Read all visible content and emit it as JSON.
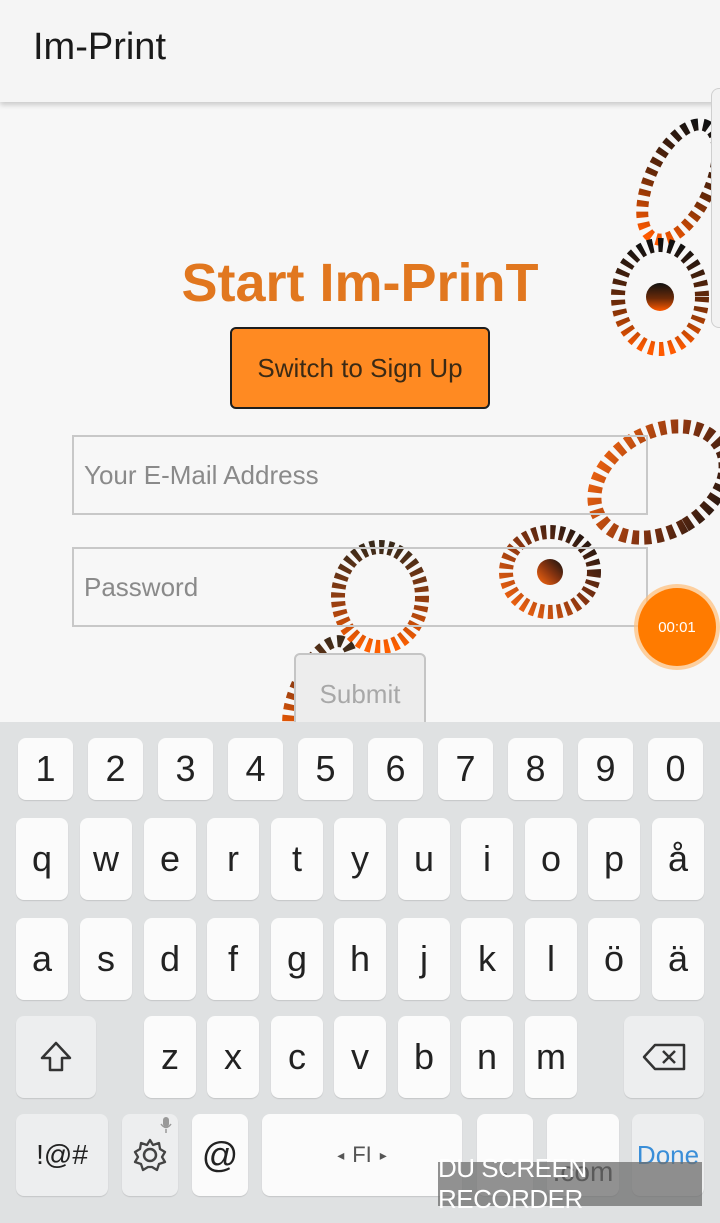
{
  "app": {
    "title": "Im-Print"
  },
  "form": {
    "headline": "Start Im-PrinT",
    "switch_label": "Switch to Sign Up",
    "email_placeholder": "Your E-Mail Address",
    "password_placeholder": "Password",
    "submit_label": "Submit"
  },
  "recorder": {
    "timer": "00:01",
    "watermark": "DU SCREEN RECORDER"
  },
  "colors": {
    "accent": "#e1771f",
    "button": "#ff8a22",
    "recorder": "#ff7b00",
    "done": "#3a8ed8"
  },
  "keyboard": {
    "number_row": [
      "1",
      "2",
      "3",
      "4",
      "5",
      "6",
      "7",
      "8",
      "9",
      "0"
    ],
    "row1": [
      "q",
      "w",
      "e",
      "r",
      "t",
      "y",
      "u",
      "i",
      "o",
      "p",
      "å"
    ],
    "row2": [
      "a",
      "s",
      "d",
      "f",
      "g",
      "h",
      "j",
      "k",
      "l",
      "ö",
      "ä"
    ],
    "row3": [
      "z",
      "x",
      "c",
      "v",
      "b",
      "n",
      "m"
    ],
    "symbols_label": "!@#",
    "at_label": "@",
    "space_label": "FI",
    "period_label": ".",
    "dotcom_label": ".com",
    "done_label": "Done",
    "shift_icon": "shift-icon",
    "backspace_icon": "backspace-icon",
    "settings_icon": "gear-icon"
  }
}
